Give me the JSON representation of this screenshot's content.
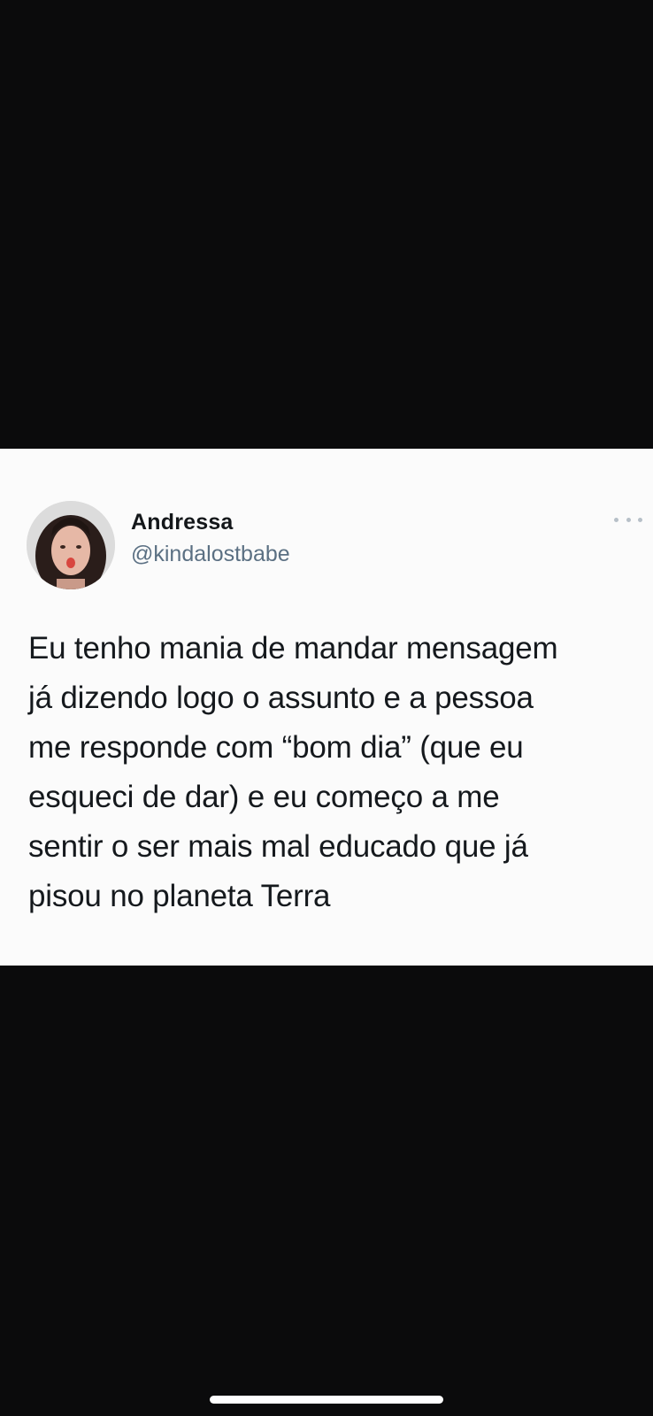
{
  "tweet": {
    "display_name": "Andressa",
    "handle": "@kindalostbabe",
    "text": "Eu tenho mania de mandar mensagem\njá dizendo logo o assunto e a pessoa\nme responde com “bom dia” (que eu\nesqueci de dar) e eu começo a me\nsentir o ser mais mal educado que já\npisou no planeta Terra",
    "more_icon": "more-horizontal-icon"
  },
  "colors": {
    "background": "#0b0b0c",
    "card": "#fbfbfb",
    "name": "#14171a",
    "handle": "#5b7083",
    "text": "#15191d"
  }
}
